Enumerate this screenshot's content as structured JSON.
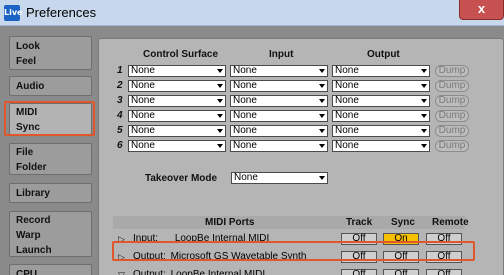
{
  "window": {
    "title": "Preferences",
    "app_icon": "Live",
    "close_label": "x"
  },
  "sidebar": {
    "tabs": [
      {
        "lines": [
          "Look",
          "Feel"
        ]
      },
      {
        "lines": [
          "Audio"
        ]
      },
      {
        "lines": [
          "MIDI",
          "Sync"
        ],
        "active": true
      },
      {
        "lines": [
          "File",
          "Folder"
        ]
      },
      {
        "lines": [
          "Library"
        ]
      },
      {
        "lines": [
          "Record",
          "Warp",
          "Launch"
        ]
      },
      {
        "lines": [
          "CPU"
        ]
      }
    ]
  },
  "midi": {
    "headers": {
      "control_surface": "Control Surface",
      "input": "Input",
      "output": "Output"
    },
    "rows": [
      {
        "num": "1",
        "control_surface": "None",
        "input": "None",
        "output": "None",
        "dump": "Dump"
      },
      {
        "num": "2",
        "control_surface": "None",
        "input": "None",
        "output": "None",
        "dump": "Dump"
      },
      {
        "num": "3",
        "control_surface": "None",
        "input": "None",
        "output": "None",
        "dump": "Dump"
      },
      {
        "num": "4",
        "control_surface": "None",
        "input": "None",
        "output": "None",
        "dump": "Dump"
      },
      {
        "num": "5",
        "control_surface": "None",
        "input": "None",
        "output": "None",
        "dump": "Dump"
      },
      {
        "num": "6",
        "control_surface": "None",
        "input": "None",
        "output": "None",
        "dump": "Dump"
      }
    ],
    "takeover": {
      "label": "Takeover Mode",
      "value": "None"
    }
  },
  "ports": {
    "headers": {
      "midi_ports": "MIDI Ports",
      "track": "Track",
      "sync": "Sync",
      "remote": "Remote"
    },
    "rows": [
      {
        "toggle": "▷",
        "type": "Input:",
        "name": "LoopBe Internal MIDI",
        "track": "Off",
        "sync": "On",
        "remote": "Off"
      },
      {
        "toggle": "▷",
        "type": "Output:",
        "name": "Microsoft GS Wavetable Synth",
        "track": "Off",
        "sync": "Off",
        "remote": "Off"
      },
      {
        "toggle": "▽",
        "type": "Output:",
        "name": "LoopBe Internal MIDI",
        "track": "Off",
        "sync": "Off",
        "remote": "Off"
      }
    ]
  },
  "colors": {
    "highlight": "#e0572e",
    "sync_on": "#f6c000"
  }
}
